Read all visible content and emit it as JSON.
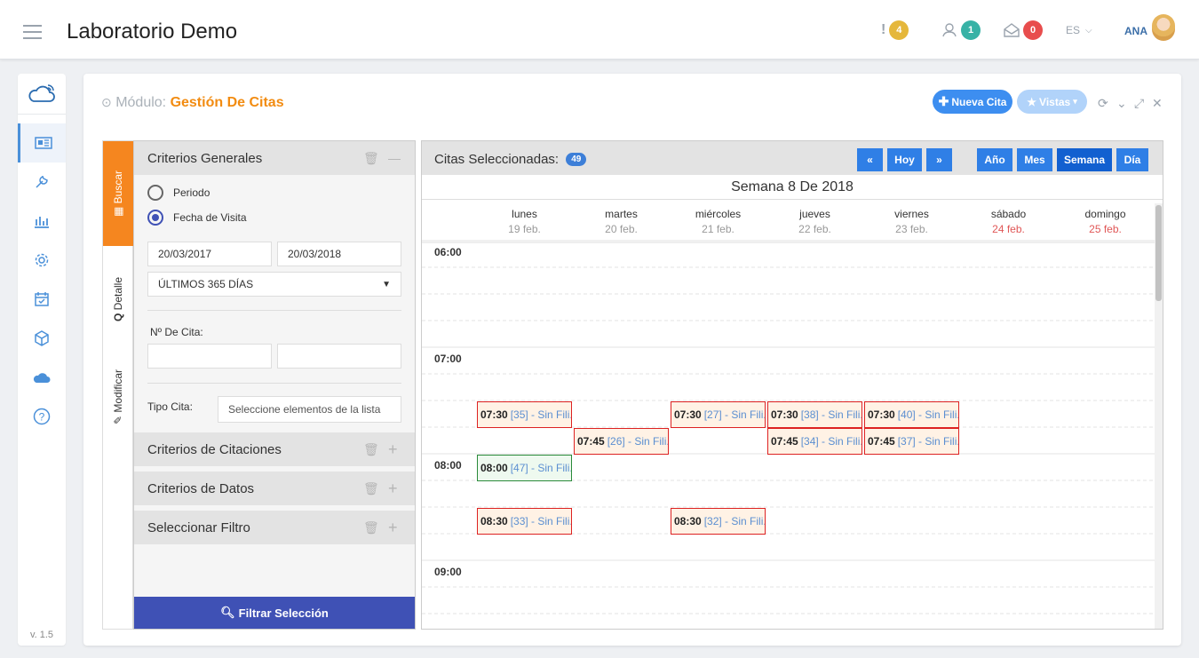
{
  "header": {
    "app_title": "Laboratorio Demo",
    "alerts_count": "4",
    "users_count": "1",
    "mail_count": "0",
    "lang": "ES",
    "user": "ANA"
  },
  "sidebar": {
    "items": [
      "news-icon",
      "wrench-icon",
      "chart-icon",
      "gear-icon",
      "calendar-check-icon",
      "box-icon",
      "cloud-icon",
      "help-icon"
    ],
    "version": "v. 1.5"
  },
  "module": {
    "prefix": "Módulo:",
    "name": "Gestión De Citas",
    "new_button": "Nueva Cita",
    "views_button": "Vistas"
  },
  "tabs": {
    "search": "Buscar",
    "detail": "Detalle",
    "modify": "Modificar"
  },
  "filters": {
    "general_title": "Criterios Generales",
    "radio_period": "Periodo",
    "radio_visit": "Fecha de Visita",
    "date_from": "20/03/2017",
    "date_to": "20/03/2018",
    "range_select": "ÚLTIMOS 365 DÍAS",
    "cita_label": "Nº De Cita:",
    "tipo_label": "Tipo Cita:",
    "tipo_placeholder": "Seleccione elementos de la lista",
    "sections": [
      "Criterios de Citaciones",
      "Criterios de Datos",
      "Seleccionar Filtro"
    ],
    "filter_button": "Filtrar Selección"
  },
  "calendar": {
    "selected_label": "Citas Seleccionadas:",
    "selected_count": "49",
    "nav": {
      "prev": "«",
      "today": "Hoy",
      "next": "»"
    },
    "views": [
      "Año",
      "Mes",
      "Semana",
      "Día"
    ],
    "active_view": "Semana",
    "week_title": "Semana 8 De 2018",
    "days": [
      {
        "name": "lunes",
        "date": "19 feb."
      },
      {
        "name": "martes",
        "date": "20 feb."
      },
      {
        "name": "miércoles",
        "date": "21 feb."
      },
      {
        "name": "jueves",
        "date": "22 feb."
      },
      {
        "name": "viernes",
        "date": "23 feb."
      },
      {
        "name": "sábado",
        "date": "24 feb."
      },
      {
        "name": "domingo",
        "date": "25 feb."
      }
    ],
    "hours": [
      "06:00",
      "07:00",
      "08:00",
      "09:00"
    ],
    "events": [
      {
        "day": 0,
        "time": "07:30",
        "text": "[35] - Sin Fili...",
        "status": "red"
      },
      {
        "day": 2,
        "time": "07:30",
        "text": "[27] - Sin Fili...",
        "status": "red"
      },
      {
        "day": 3,
        "time": "07:30",
        "text": "[38] - Sin Fili...",
        "status": "red"
      },
      {
        "day": 4,
        "time": "07:30",
        "text": "[40] - Sin Fili...",
        "status": "red"
      },
      {
        "day": 1,
        "time": "07:45",
        "text": "[26] - Sin Fili...",
        "status": "red"
      },
      {
        "day": 3,
        "time": "07:45",
        "text": "[34] - Sin Fili...",
        "status": "red"
      },
      {
        "day": 4,
        "time": "07:45",
        "text": "[37] - Sin Fili...",
        "status": "red"
      },
      {
        "day": 0,
        "time": "08:00",
        "text": "[47] - Sin Fili...",
        "status": "green"
      },
      {
        "day": 0,
        "time": "08:30",
        "text": "[33] - Sin Fili...",
        "status": "red"
      },
      {
        "day": 2,
        "time": "08:30",
        "text": "[32] - Sin Fili...",
        "status": "red"
      }
    ]
  }
}
